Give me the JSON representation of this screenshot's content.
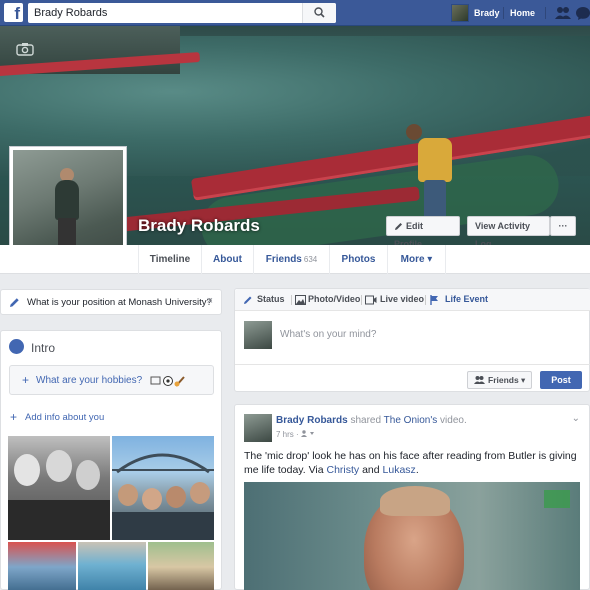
{
  "topbar": {
    "logo": "f",
    "search_value": "Brady Robards",
    "user_name": "Brady",
    "home_label": "Home"
  },
  "profile": {
    "name": "Brady Robards",
    "edit_profile_label": "Edit Profile",
    "activity_log_label": "View Activity Log",
    "more_dots": "···"
  },
  "tabs": [
    {
      "label": "Timeline"
    },
    {
      "label": "About"
    },
    {
      "label": "Friends",
      "count": "634"
    },
    {
      "label": "Photos"
    },
    {
      "label": "More ▾"
    }
  ],
  "question": {
    "text": "What is your position at Monash University?",
    "close": "×"
  },
  "intro": {
    "title": "Intro",
    "hobbies_prompt": "What are your hobbies?",
    "add_info": "Add info about you",
    "plus": "+"
  },
  "composer": {
    "tabs": [
      "Status",
      "Photo/Video",
      "Live video",
      "Life Event"
    ],
    "placeholder": "What's on your mind?",
    "audience_label": "Friends ▾",
    "post_label": "Post"
  },
  "post": {
    "author": "Brady Robards",
    "action": "shared",
    "source": "The Onion's",
    "object": "video.",
    "time": "7 hrs",
    "text_before": "The 'mic drop' look he has on his face after reading from Butler is giving me life today. Via ",
    "mention1": "Christy",
    "text_and": " and ",
    "mention2": "Lukasz",
    "text_end": "."
  },
  "colors": {
    "brand": "#3b5998",
    "link": "#365899",
    "button": "#4267b2"
  }
}
